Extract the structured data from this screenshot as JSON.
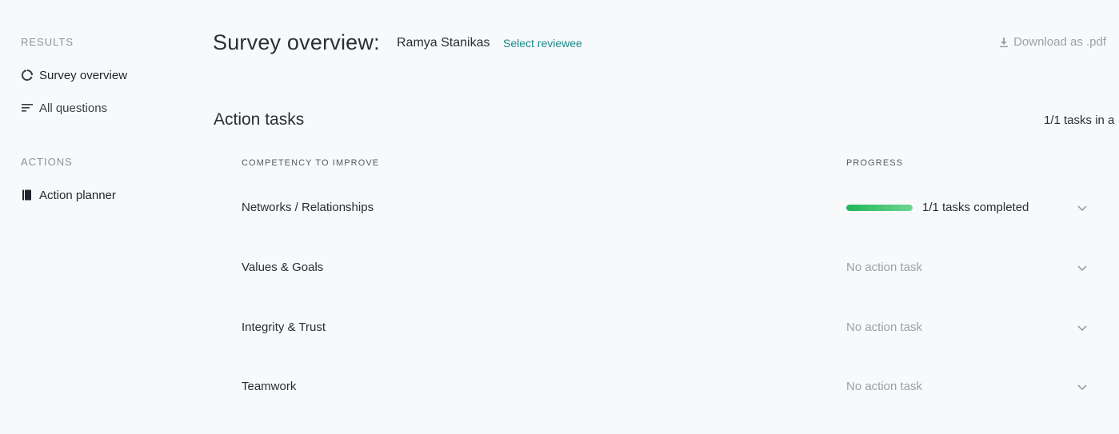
{
  "sidebar": {
    "results_label": "RESULTS",
    "results_items": [
      {
        "label": "Survey overview",
        "icon": "donut-chart-icon"
      },
      {
        "label": "All questions",
        "icon": "list-lines-icon"
      }
    ],
    "actions_label": "ACTIONS",
    "actions_items": [
      {
        "label": "Action planner",
        "icon": "book-icon"
      }
    ]
  },
  "header": {
    "title": "Survey overview:",
    "reviewee_name": "Ramya Stanikas",
    "select_reviewee_label": "Select reviewee",
    "download_label": "Download as .pdf"
  },
  "action_tasks": {
    "title": "Action tasks",
    "summary": "1/1 tasks in a",
    "columns": {
      "competency": "COMPETENCY TO IMPROVE",
      "progress": "PROGRESS"
    },
    "rows": [
      {
        "competency": "Networks / Relationships",
        "progress_text": "1/1 tasks completed",
        "progress_fraction": 1.0
      },
      {
        "competency": "Values & Goals",
        "progress_text": "No action task"
      },
      {
        "competency": "Integrity & Trust",
        "progress_text": "No action task"
      },
      {
        "competency": "Teamwork",
        "progress_text": "No action task"
      }
    ]
  },
  "colors": {
    "background": "#f8f9fb",
    "accent_link": "#1a8a8a",
    "progress_green": "#1fb757",
    "muted_text": "#9ba0a8"
  }
}
